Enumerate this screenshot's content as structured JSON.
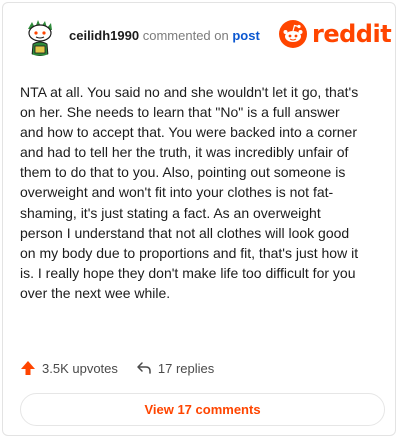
{
  "header": {
    "username": "ceilidh1990",
    "action_text": "commented on",
    "post_link": "post"
  },
  "logo": {
    "wordmark": "reddit",
    "brand_color": "#ff4500",
    "icon": "reddit-snoo-icon"
  },
  "comment": {
    "text": "NTA at all. You said no and she wouldn't let it go, that's on her. She needs to learn that \"No\" is a full answer and how to accept that. You were backed into a corner and had to tell her the truth, it was incredibly unfair of them to do that to you. Also, pointing out someone is overweight and won't fit into your clothes is not fat-shaming, it's just stating a fact. As an overweight person I understand that not all clothes will look good on my body due to proportions and fit, that's just how it is. I really hope they don't make life too difficult for you over the next wee while."
  },
  "actions": {
    "upvotes": "3.5K upvotes",
    "replies": "17 replies",
    "upvote_icon": "upvote-arrow-icon",
    "reply_icon": "reply-arrow-icon"
  },
  "view_comments": {
    "label": "View 17 comments"
  }
}
